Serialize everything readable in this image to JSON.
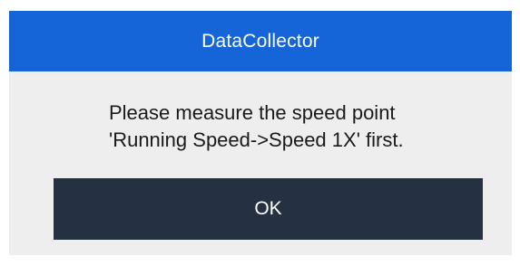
{
  "dialog": {
    "title": "DataCollector",
    "message_line1": "Please measure the speed point",
    "message_line2": "'Running Speed->Speed 1X' first.",
    "ok_label": "OK"
  },
  "colors": {
    "title_bar": "#1565d8",
    "body": "#eeeeee",
    "button": "#253142",
    "text": "#1a1a1a"
  }
}
